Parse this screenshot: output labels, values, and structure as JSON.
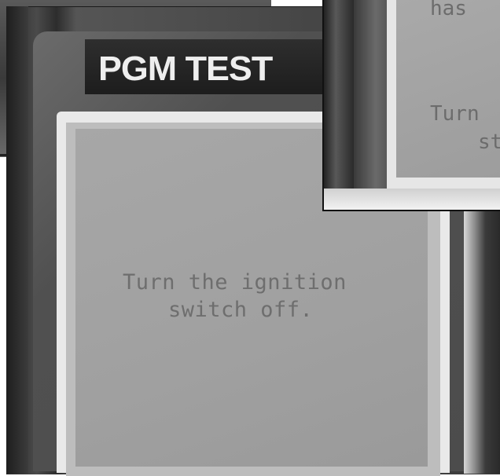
{
  "device": {
    "brand_label": "PGM TEST",
    "lcd_lines": [
      "Turn the ignition",
      "switch off."
    ]
  },
  "inset": {
    "lcd_lines": [
      "has",
      "Turn",
      "st"
    ]
  },
  "colors": {
    "lcd_background": "#a3a3a3",
    "lcd_text": "#6e6e6e",
    "brand_text": "#eeeeee",
    "label_plate": "#262626"
  }
}
